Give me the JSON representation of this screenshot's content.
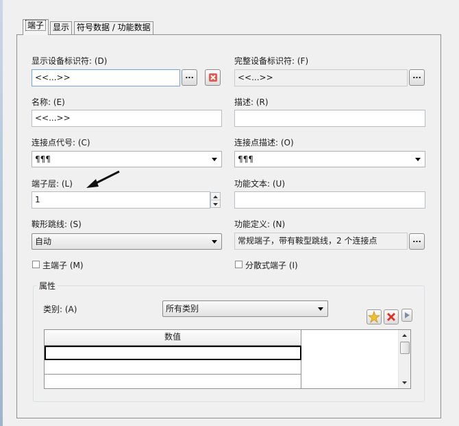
{
  "tabs": [
    {
      "label": "端子"
    },
    {
      "label": "显示"
    },
    {
      "label": "符号数据 / 功能数据"
    }
  ],
  "form": {
    "display_id": {
      "label": "显示设备标识符: (D)",
      "value": "<<...>>"
    },
    "full_id": {
      "label": "完整设备标识符: (F)",
      "value": "<<...>>"
    },
    "name": {
      "label": "名称: (E)",
      "value": "<<...>>"
    },
    "description": {
      "label": "描述: (R)",
      "value": ""
    },
    "connection_code": {
      "label": "连接点代号: (C)",
      "value": "¶¶¶"
    },
    "connection_desc": {
      "label": "连接点描述: (O)",
      "value": "¶¶¶"
    },
    "terminal_level": {
      "label": "端子层: (L)",
      "value": "1"
    },
    "function_text": {
      "label": "功能文本: (U)",
      "value": ""
    },
    "saddle_jumper": {
      "label": "鞍形跳线: (S)",
      "value": "自动"
    },
    "function_def": {
      "label": "功能定义: (N)",
      "value": "常规端子，带有鞍型跳线，2 个连接点"
    },
    "main_terminal": {
      "label": "主端子 (M)",
      "checked": false
    },
    "distributed_terminal": {
      "label": "分散式端子 (I)",
      "checked": false
    }
  },
  "properties": {
    "group_title": "属性",
    "category_label": "类别: (A)",
    "category_value": "所有类别",
    "grid_header": "数值",
    "rows": [
      "",
      "",
      ""
    ]
  },
  "buttons": {
    "browse": "...",
    "remove": "✖"
  },
  "colors": {
    "accent_red": "#d9342b",
    "star_yellow": "#f2c12e",
    "field_border": "#b4bcc5",
    "focus_border": "#6ea4d8"
  },
  "icons": [
    "delete-icon",
    "new-star-icon",
    "play-arrow-icon",
    "spin-up-icon",
    "spin-down-icon",
    "dropdown-arrow-icon",
    "pointer-arrow-icon"
  ]
}
